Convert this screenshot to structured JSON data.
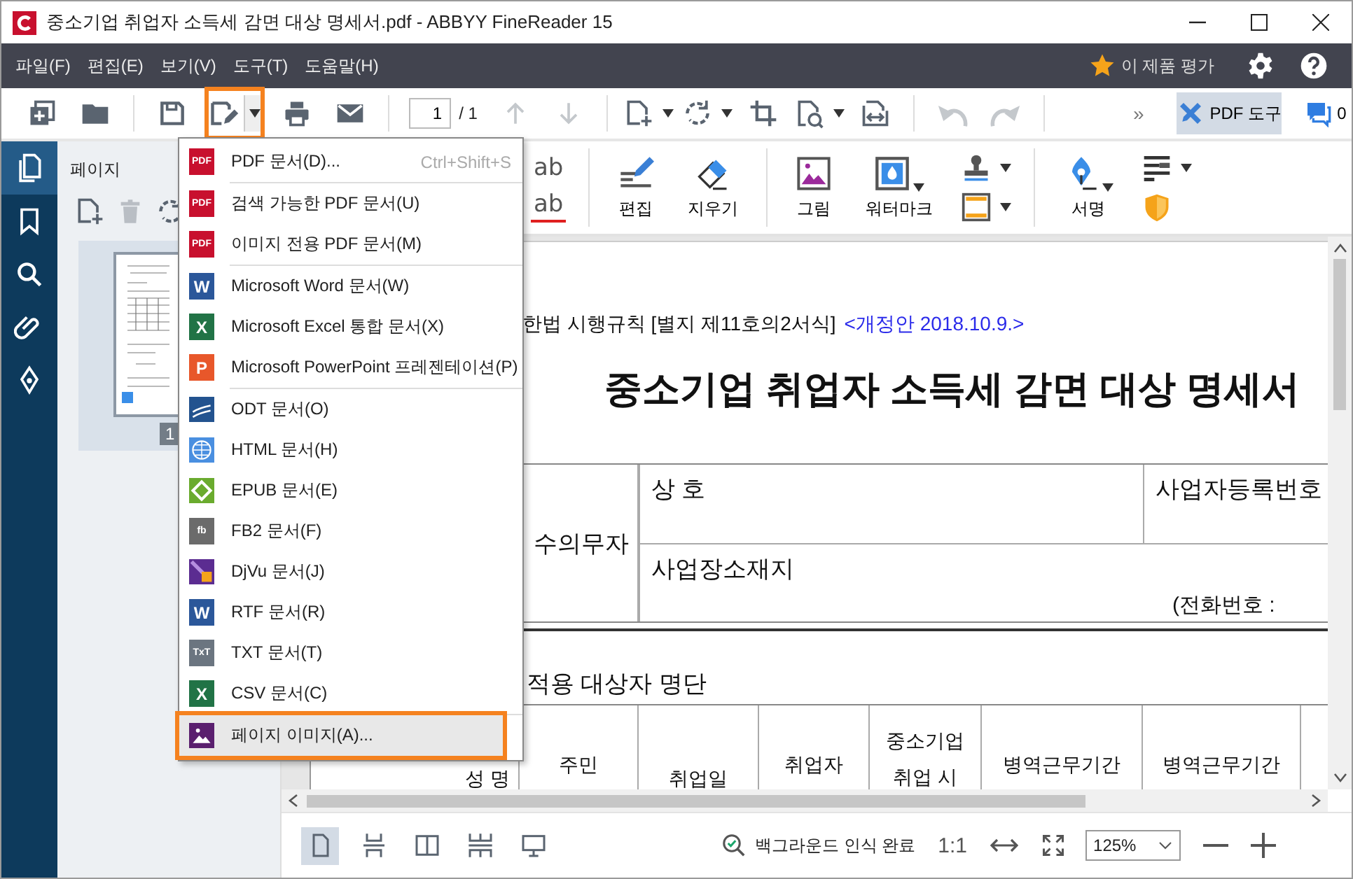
{
  "window": {
    "title": "중소기업 취업자 소득세 감면 대상 명세서.pdf - ABBYY FineReader 15"
  },
  "menu_bar": {
    "items": [
      "파일(F)",
      "편집(E)",
      "보기(V)",
      "도구(T)",
      "도움말(H)"
    ],
    "rate_label": "이 제품 평가"
  },
  "toolbar": {
    "items": [
      {
        "kind": "new",
        "disabled": false
      },
      {
        "kind": "open",
        "disabled": false
      },
      {
        "kind": "sep"
      },
      {
        "kind": "save",
        "disabled": false
      },
      {
        "kind": "save_as",
        "disabled": false,
        "dropdown": true,
        "callout": true
      },
      {
        "kind": "print",
        "disabled": false
      },
      {
        "kind": "mail",
        "disabled": false
      },
      {
        "kind": "sep"
      },
      {
        "kind": "page",
        "value": "1",
        "total": "/ 1"
      },
      {
        "kind": "up",
        "disabled": true
      },
      {
        "kind": "down",
        "disabled": true
      },
      {
        "kind": "sep"
      },
      {
        "kind": "add_page",
        "disabled": false,
        "dropdown": true
      },
      {
        "kind": "rotate",
        "disabled": false,
        "dropdown": true
      },
      {
        "kind": "crop",
        "disabled": false
      },
      {
        "kind": "recognize",
        "disabled": false,
        "dropdown": true
      },
      {
        "kind": "compare",
        "disabled": false
      },
      {
        "kind": "sep"
      },
      {
        "kind": "undo",
        "disabled": true
      },
      {
        "kind": "redo",
        "disabled": true
      },
      {
        "kind": "sep"
      },
      {
        "kind": "more",
        "label": "»"
      },
      {
        "kind": "pdf_tools",
        "label": "PDF 도구",
        "on": true
      },
      {
        "kind": "comments",
        "label": "0"
      }
    ]
  },
  "rail": [
    {
      "kind": "pages",
      "selected": true
    },
    {
      "kind": "bookmarks",
      "selected": false
    },
    {
      "kind": "search",
      "selected": false
    },
    {
      "kind": "attachments",
      "selected": false
    },
    {
      "kind": "signatures",
      "selected": false
    }
  ],
  "pages_panel": {
    "title": "페이지",
    "thumbnails": [
      {
        "number": "1",
        "selected": true
      }
    ]
  },
  "pdf_toolbar": {
    "groups": [
      {
        "tools": [
          {
            "kind": "stack",
            "items": [
              {
                "kind": "insert_text",
                "label": "ab"
              },
              {
                "kind": "strike_text",
                "label": "ab"
              }
            ]
          }
        ]
      },
      {
        "tools": [
          {
            "kind": "edit",
            "label": "편집"
          },
          {
            "kind": "erase",
            "label": "지우기"
          }
        ]
      },
      {
        "tools": [
          {
            "kind": "image",
            "label": "그림"
          },
          {
            "kind": "watermark",
            "label": "워터마크",
            "dropdown": true
          },
          {
            "kind": "stack",
            "items": [
              {
                "kind": "stamp",
                "dropdown": true
              },
              {
                "kind": "header_footer",
                "dropdown": true
              }
            ]
          }
        ]
      },
      {
        "tools": [
          {
            "kind": "signature",
            "label": "서명",
            "dropdown": true
          },
          {
            "kind": "stack",
            "items": [
              {
                "kind": "redact",
                "dropdown": true
              },
              {
                "kind": "protect"
              }
            ]
          }
        ]
      }
    ]
  },
  "export_menu": {
    "sections": [
      [
        {
          "kind": "pdf",
          "glyph": "PDF",
          "label": "PDF 문서(D)...",
          "shortcut": "Ctrl+Shift+S",
          "selected": false,
          "callout": false
        }
      ],
      [
        {
          "kind": "pdf",
          "glyph": "PDF",
          "label": "검색 가능한 PDF 문서(U)",
          "selected": false,
          "callout": false
        },
        {
          "kind": "pdf",
          "glyph": "PDF",
          "label": "이미지 전용 PDF 문서(M)",
          "selected": false,
          "callout": false
        }
      ],
      [
        {
          "kind": "word",
          "glyph": "W",
          "label": "Microsoft Word 문서(W)",
          "selected": false,
          "callout": false
        },
        {
          "kind": "excel",
          "glyph": "X",
          "label": "Microsoft Excel 통합 문서(X)",
          "selected": false,
          "callout": false
        },
        {
          "kind": "powerpoint",
          "glyph": "P",
          "label": "Microsoft PowerPoint 프레젠테이션(P)",
          "selected": false,
          "callout": false
        }
      ],
      [
        {
          "kind": "odt",
          "label": "ODT 문서(O)",
          "selected": false,
          "callout": false
        },
        {
          "kind": "html",
          "label": "HTML 문서(H)",
          "selected": false,
          "callout": false
        },
        {
          "kind": "epub",
          "label": "EPUB 문서(E)",
          "selected": false,
          "callout": false
        },
        {
          "kind": "fb2",
          "glyph": "fb",
          "label": "FB2 문서(F)",
          "selected": false,
          "callout": false
        },
        {
          "kind": "djvu",
          "label": "DjVu 문서(J)",
          "selected": false,
          "callout": false
        },
        {
          "kind": "word",
          "glyph": "W",
          "label": "RTF 문서(R)",
          "selected": false,
          "callout": false
        },
        {
          "kind": "txt",
          "glyph": "TxT",
          "label": "TXT 문서(T)",
          "selected": false,
          "callout": false
        },
        {
          "kind": "excel",
          "glyph": "X",
          "label": "CSV 문서(C)",
          "selected": false,
          "callout": false
        }
      ],
      [
        {
          "kind": "image",
          "label": "페이지 이미지(A)...",
          "selected": true,
          "callout": true
        }
      ]
    ]
  },
  "document": {
    "form_note": "한법 시행규칙 [별지 제11호의2서식]",
    "revision": "<개정안 2018.10.9.>",
    "title": "중소기업 취업자 소득세 감면 대상 명세서",
    "withholder": {
      "label": "수의무자",
      "name_label": "상 호",
      "reg_label": "사업자등록번호",
      "address_label": "사업장소재지",
      "phone_label": "(전화번호 :"
    },
    "section": "적용 대상자 명단",
    "columns": [
      [
        "성 명"
      ],
      [
        "주민"
      ],
      [
        "취업일"
      ],
      [
        "취업자"
      ],
      [
        "중소기업",
        "취업 시"
      ],
      [
        "병역근무기간"
      ],
      [
        "병역근무기간"
      ]
    ]
  },
  "status_bar": {
    "views": [
      {
        "kind": "single",
        "selected": true
      },
      {
        "kind": "scroll",
        "selected": false
      },
      {
        "kind": "two",
        "selected": false
      },
      {
        "kind": "two_scroll",
        "selected": false
      },
      {
        "kind": "present",
        "selected": false
      }
    ],
    "status": "백그라운드 인식 완료",
    "actual_size": "1:1",
    "zoom": "125%"
  }
}
